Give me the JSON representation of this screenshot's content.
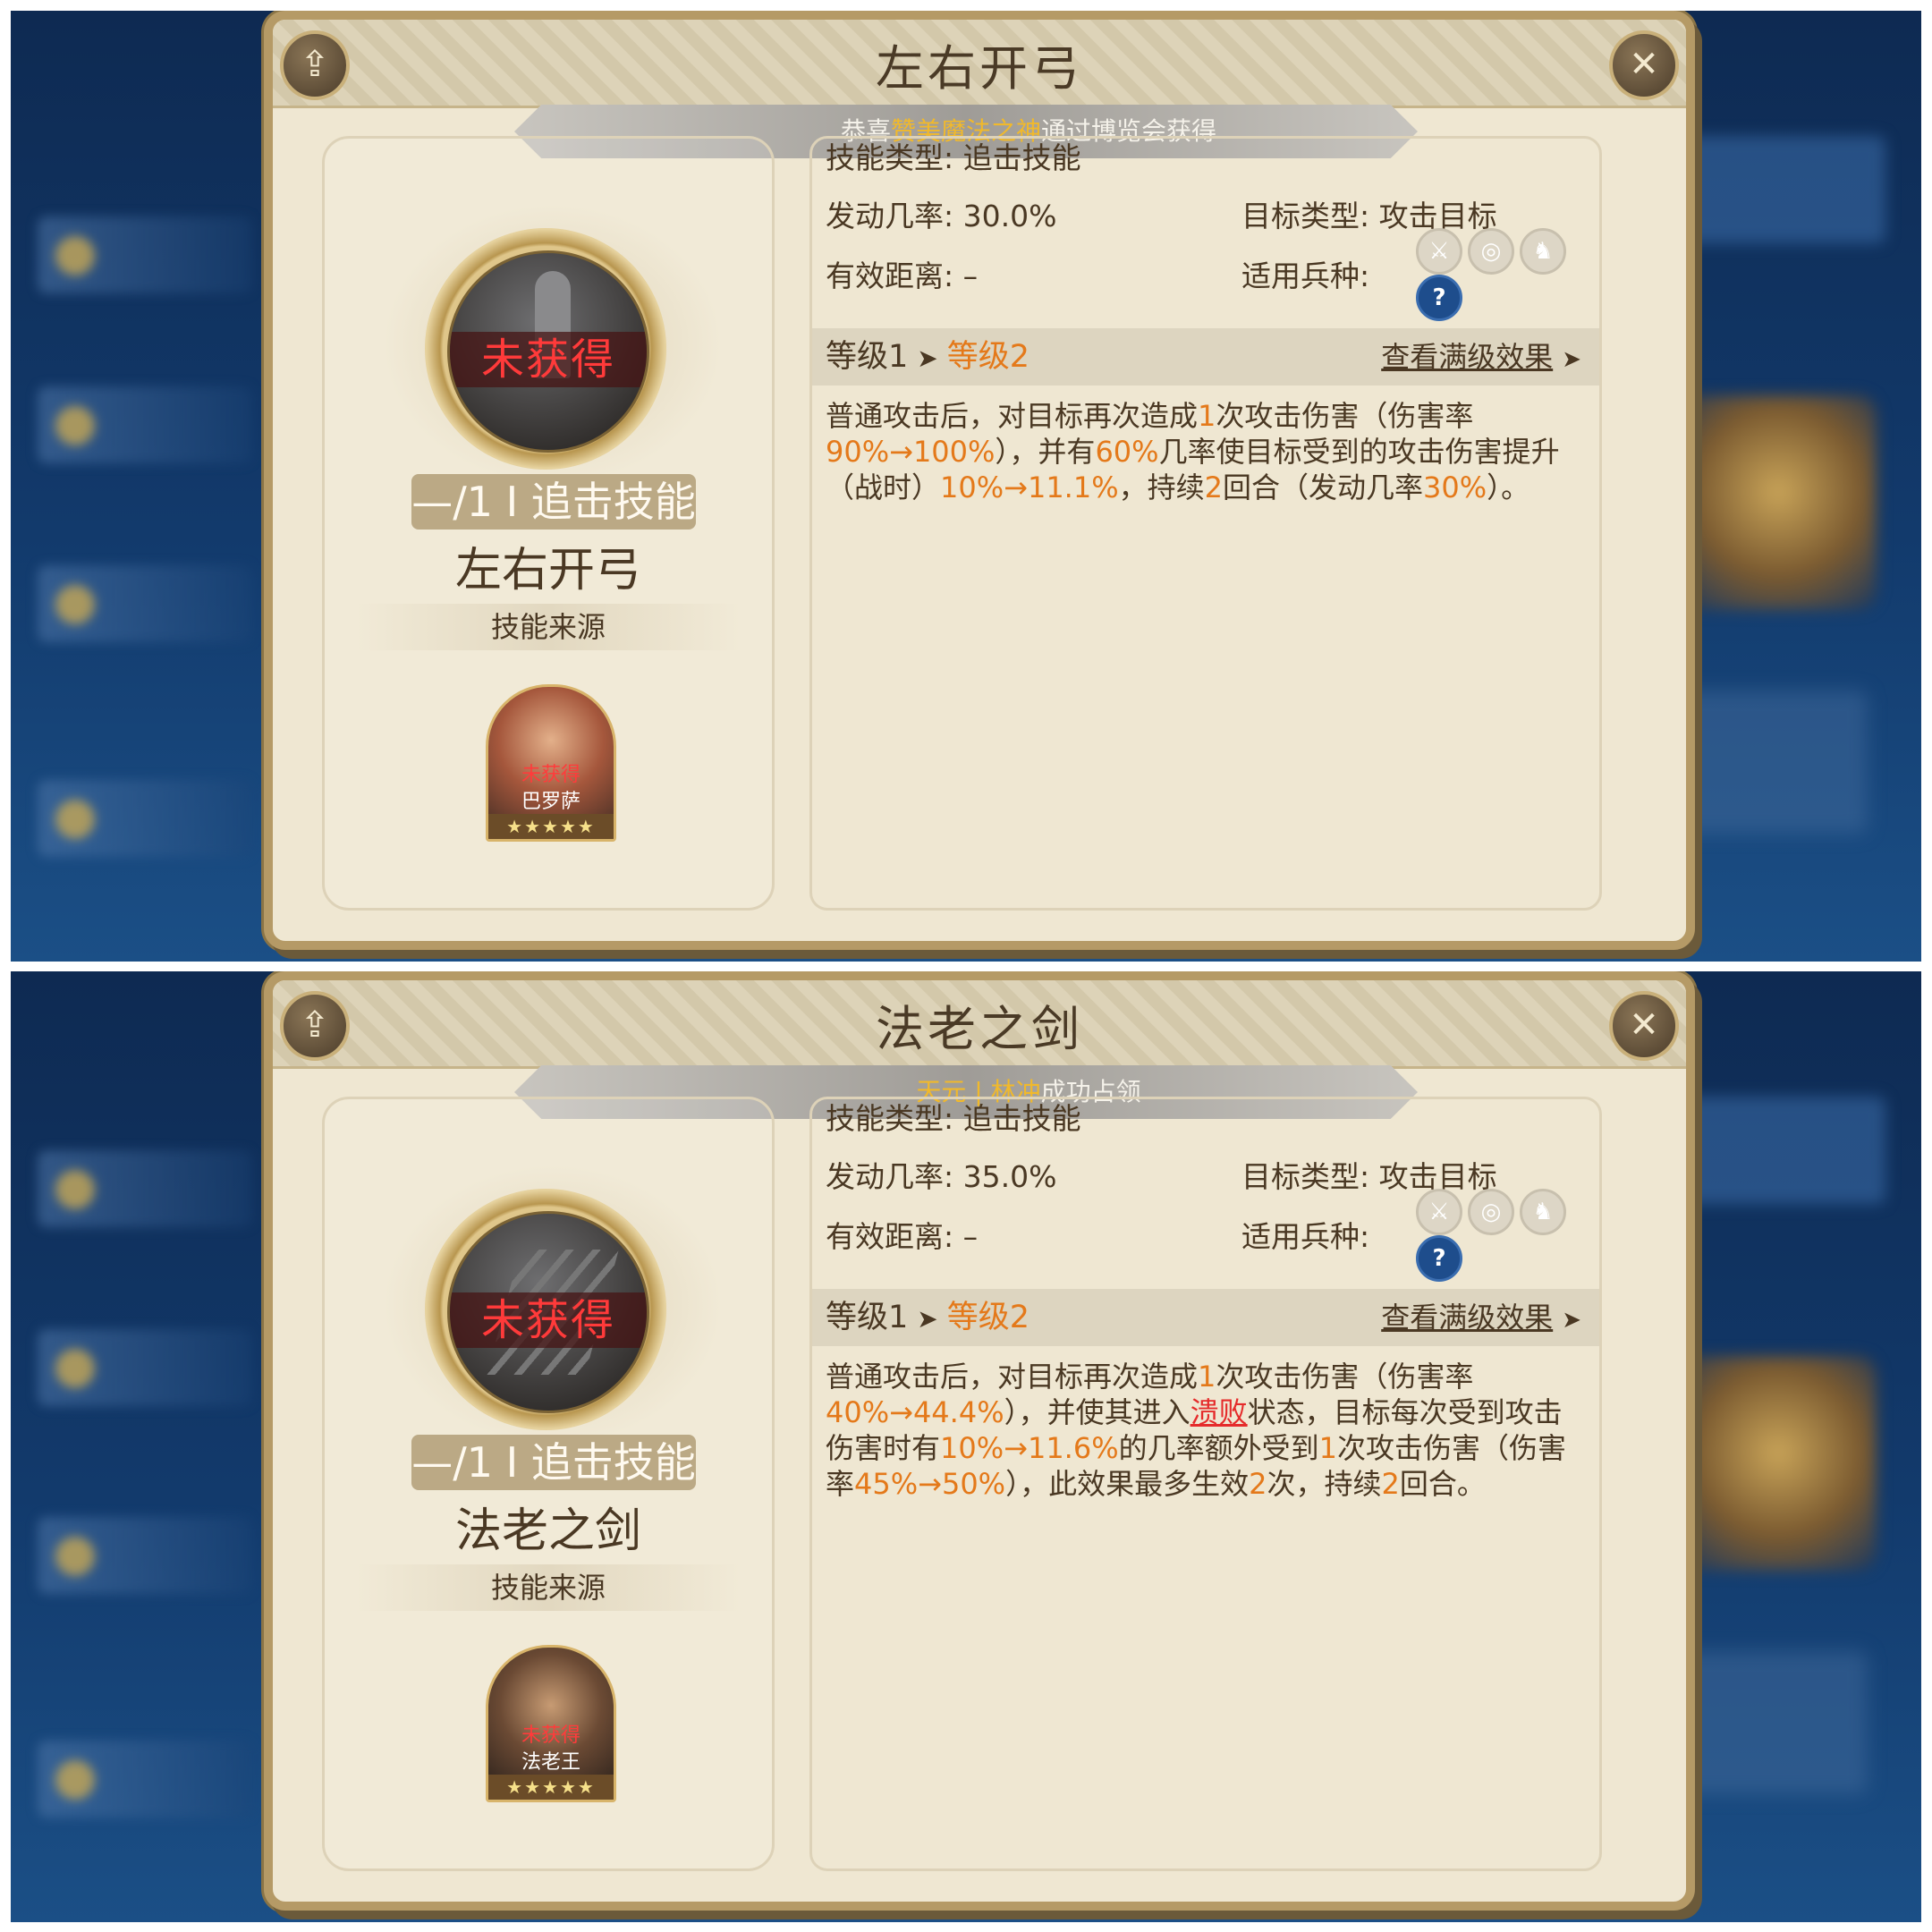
{
  "panels": [
    {
      "title": "左右开弓",
      "share_icon": "share-icon",
      "close_icon": "close-icon",
      "banner": {
        "prefix": "恭喜",
        "highlight": "赞美魔法之神",
        "suffix": "通过博览会获得"
      },
      "status_label": "未获得",
      "skill_tag": "—/1 I 追击技能",
      "skill_name": "左右开弓",
      "source_label": "技能来源",
      "hero": {
        "status": "未获得",
        "name": "巴罗萨",
        "stars": "★★★★★"
      },
      "info": {
        "type_label": "技能类型:",
        "type_value": "追击技能",
        "rate_label": "发动几率:",
        "rate_value": "30.0%",
        "target_label": "目标类型:",
        "target_value": "攻击目标",
        "range_label": "有效距离:",
        "range_value": "–",
        "troops_label": "适用兵种:",
        "troop_icons": [
          "sword-icon",
          "target-icon",
          "horse-icon",
          "question-icon"
        ]
      },
      "level": {
        "from": "等级1",
        "arrow": "➤",
        "to": "等级2",
        "max_link": "查看满级效果",
        "max_arrow": "➤"
      },
      "desc": {
        "t1": "普通攻击后，对目标再次造成",
        "o1": "1",
        "t2": "次攻击伤害（伤害率",
        "o2": "90%→100%",
        "t3": "），并有",
        "o3": "60%",
        "t4": "几率使目标受到的攻击伤害提升（战时）",
        "o4": "10%→11.1%",
        "t5": "，持续",
        "o5": "2",
        "t6": "回合（发动几率",
        "o6": "30%",
        "t7": "）。"
      }
    },
    {
      "title": "法老之剑",
      "share_icon": "share-icon",
      "close_icon": "close-icon",
      "banner": {
        "prefix": "",
        "highlight": "天元 | 林冲",
        "suffix": "成功占领"
      },
      "status_label": "未获得",
      "skill_tag": "—/1 I 追击技能",
      "skill_name": "法老之剑",
      "source_label": "技能来源",
      "hero": {
        "status": "未获得",
        "name": "法老王",
        "stars": "★★★★★"
      },
      "info": {
        "type_label": "技能类型:",
        "type_value": "追击技能",
        "rate_label": "发动几率:",
        "rate_value": "35.0%",
        "target_label": "目标类型:",
        "target_value": "攻击目标",
        "range_label": "有效距离:",
        "range_value": "–",
        "troops_label": "适用兵种:",
        "troop_icons": [
          "sword-icon",
          "target-icon",
          "horse-icon",
          "question-icon"
        ]
      },
      "level": {
        "from": "等级1",
        "arrow": "➤",
        "to": "等级2",
        "max_link": "查看满级效果",
        "max_arrow": "➤"
      },
      "desc": {
        "t1": "普通攻击后，对目标再次造成",
        "o1": "1",
        "t2": "次攻击伤害（伤害率",
        "o2": "40%→44.4%",
        "t3": "），并使其进入",
        "r1": "溃败",
        "t4": "状态，目标每次受到攻击伤害时有",
        "o3": "10%→11.6%",
        "t5": "的几率额外受到",
        "o4": "1",
        "t6": "次攻击伤害（伤害率",
        "o5": "45%→50%",
        "t7": "），此效果最多生效",
        "o6": "2",
        "t8": "次，持续",
        "o7": "2",
        "t9": "回合。"
      }
    }
  ]
}
